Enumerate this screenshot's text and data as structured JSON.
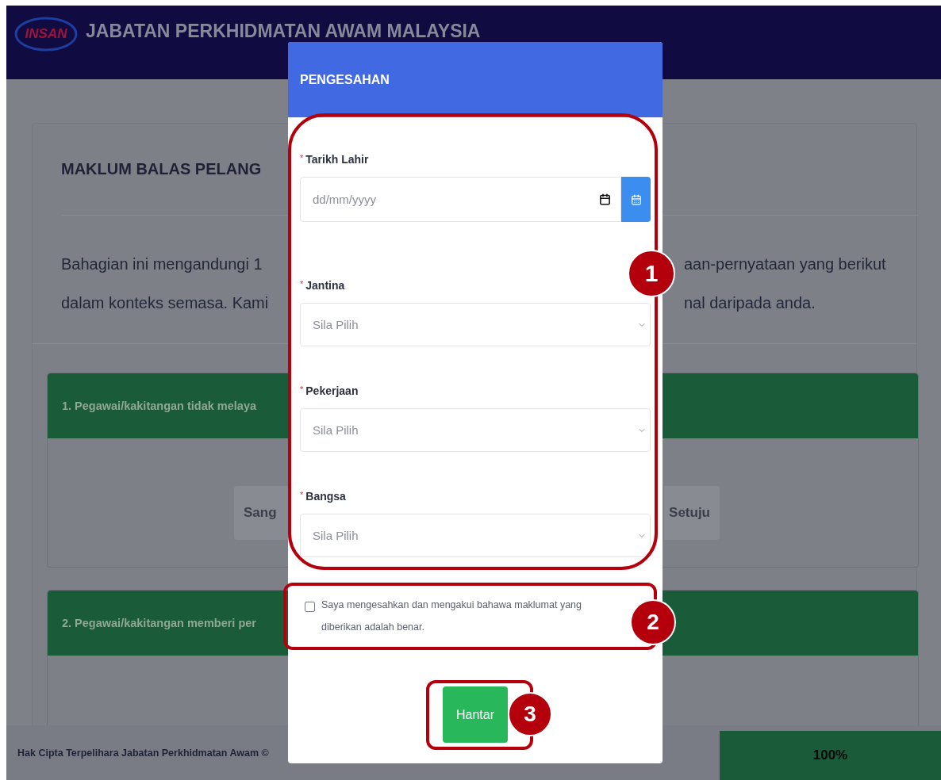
{
  "header": {
    "logo_text": "INSAN",
    "title": "JABATAN PERKHIDMATAN AWAM MALAYSIA"
  },
  "page": {
    "heading": "MAKLUM BALAS PELANG",
    "intro_left": [
      "Bahagian ini mengandungi 1",
      "dalam konteks semasa. Kami"
    ],
    "intro_right": [
      "aan-pernyataan yang berikut",
      "nal daripada anda."
    ]
  },
  "questions": [
    {
      "title": "1. Pegawai/kakitangan tidak melaya",
      "option_left": "Sang",
      "option_right": "Setuju"
    },
    {
      "title": "2. Pegawai/kakitangan memberi per"
    }
  ],
  "footer": {
    "copyright": "Hak Cipta Terpelihara Jabatan Perkhidmatan Awam ©",
    "progress": "100%",
    "level": 1
  },
  "dialog": {
    "title": "PENGESAHAN",
    "fields": [
      {
        "kind": "date",
        "marker": "*",
        "label": "Tarikh Lahir",
        "placeholder": "dd/mm/yyyy"
      },
      {
        "kind": "select",
        "marker": "*",
        "label": "Jantina",
        "placeholder": "Sila Pilih"
      },
      {
        "kind": "select",
        "marker": "*",
        "label": "Pekerjaan",
        "placeholder": "Sila Pilih"
      },
      {
        "kind": "select",
        "marker": "*",
        "label": "Bangsa",
        "placeholder": "Sila Pilih"
      }
    ],
    "consent": {
      "text": "Saya mengesahkan dan mengakui bahawa maklumat yang diberikan adalah benar.",
      "checked": false
    },
    "submit": "Hantar"
  },
  "annotations": [
    {
      "number": "1"
    },
    {
      "number": "2"
    },
    {
      "number": "3"
    }
  ]
}
